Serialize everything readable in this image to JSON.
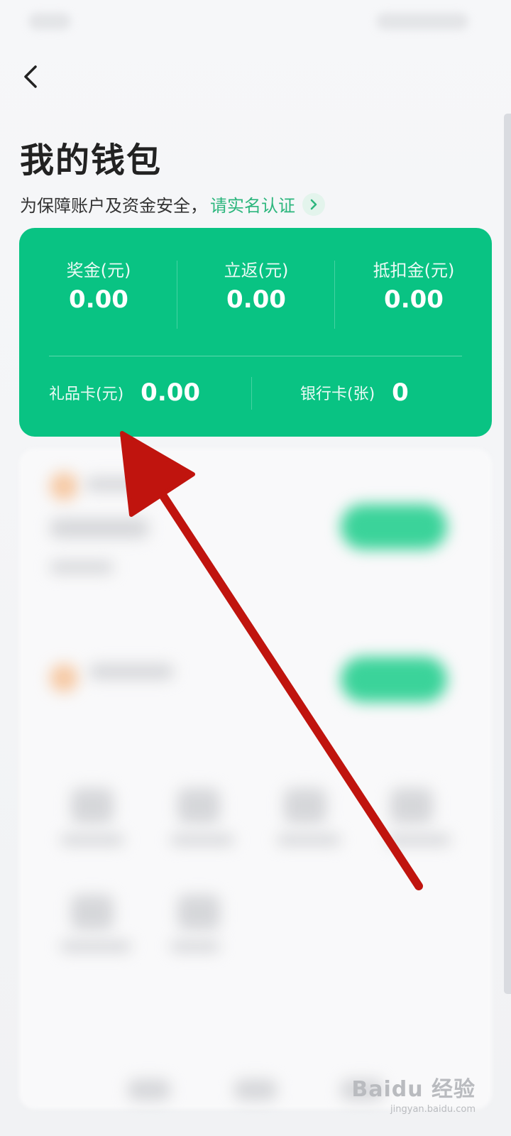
{
  "header": {
    "title": "我的钱包",
    "notice_text": "为保障账户及资金安全，",
    "verify_link": "请实名认证"
  },
  "wallet_card": {
    "metrics": [
      {
        "label": "奖金(元)",
        "value": "0.00"
      },
      {
        "label": "立返(元)",
        "value": "0.00"
      },
      {
        "label": "抵扣金(元)",
        "value": "0.00"
      }
    ],
    "gift_card": {
      "label": "礼品卡(元)",
      "value": "0.00"
    },
    "bank_card": {
      "label": "银行卡(张)",
      "value": "0"
    }
  },
  "watermark": {
    "title": "Baidu 经验",
    "domain": "jingyan.baidu.com"
  },
  "icons": [
    "back-icon",
    "chevron-right-icon"
  ],
  "colors": {
    "accent": "#09c383",
    "link": "#2cb67d",
    "annotation_arrow": "#c0140e"
  }
}
